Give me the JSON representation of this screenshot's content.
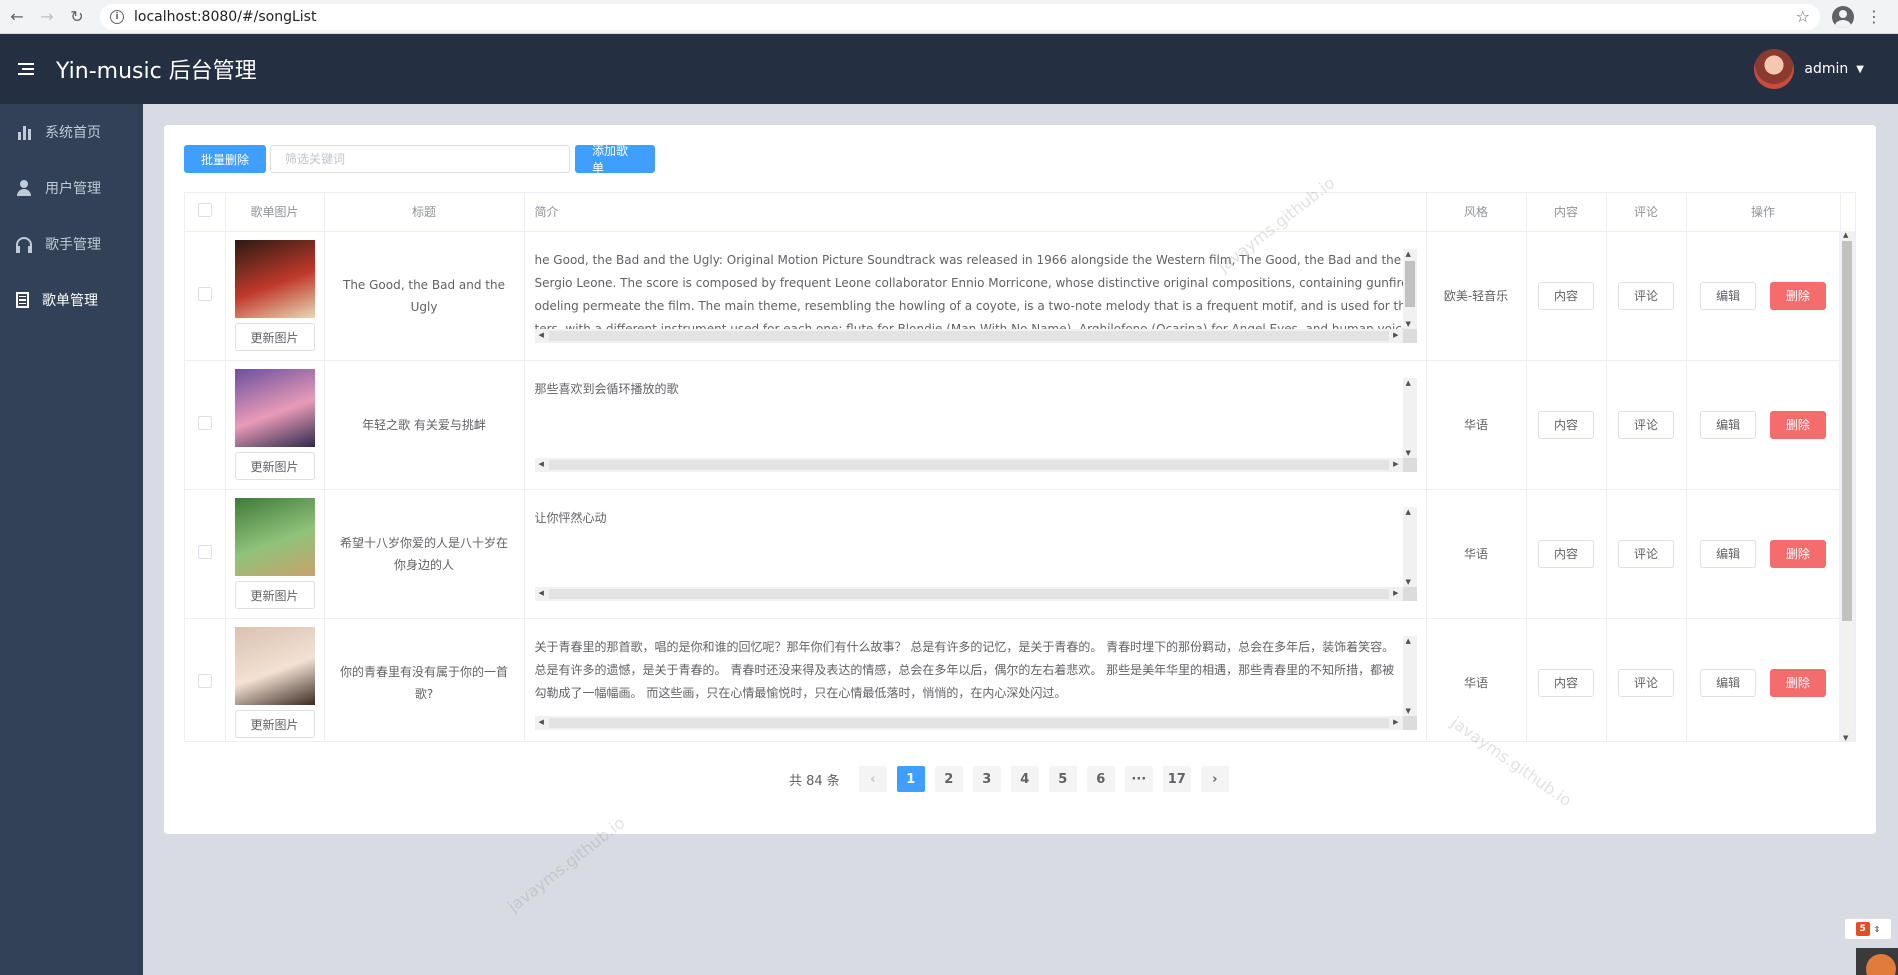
{
  "browser": {
    "url": "localhost:8080/#/songList"
  },
  "header": {
    "title": "Yin-music 后台管理",
    "user_name": "admin"
  },
  "sidebar": {
    "items": [
      {
        "label": "系统首页",
        "icon": "bar-chart-icon",
        "active": false
      },
      {
        "label": "用户管理",
        "icon": "user-icon",
        "active": false
      },
      {
        "label": "歌手管理",
        "icon": "headset-icon",
        "active": false
      },
      {
        "label": "歌单管理",
        "icon": "document-icon",
        "active": true
      }
    ]
  },
  "toolbar": {
    "batch_delete_label": "批量删除",
    "search_placeholder": "筛选关键词",
    "add_label": "添加歌单"
  },
  "table": {
    "headers": {
      "cover": "歌单图片",
      "title": "标题",
      "intro": "简介",
      "style": "风格",
      "content": "内容",
      "comment": "评论",
      "actions": "操作"
    },
    "update_image_label": "更新图片",
    "content_btn_label": "内容",
    "comment_btn_label": "评论",
    "edit_label": "编辑",
    "delete_label": "删除",
    "rows": [
      {
        "title": "The Good, the Bad and the Ugly",
        "intro_lines": [
          "he Good, the Bad and the Ugly: Original Motion Picture Soundtrack was released in 1966 alongside the Western film, The Good, the Bad and the Ugly, directed by",
          "Sergio Leone. The score is composed by frequent Leone collaborator Ennio Morricone, whose distinctive original compositions, containing gunfire, whistling, and y",
          "odeling permeate the film. The main theme, resembling the howling of a coyote, is a two-note melody that is a frequent motif, and is used for the three main charac",
          "ters, with a different instrument used for each one: flute for Blondie (Man With No Name), Arghilofono (Ocarina) for Angel Eyes, and human voices for Tuco."
        ],
        "style": "欧美-轻音乐",
        "cover_colors": [
          "#2b1a12",
          "#c0392b",
          "#e8d9b5"
        ]
      },
      {
        "title": "年轻之歌 有关爱与挑衅",
        "intro_lines": [
          "那些喜欢到会循环播放的歌"
        ],
        "style": "华语",
        "cover_colors": [
          "#6b4f9e",
          "#e89bb8",
          "#2d2a4a"
        ]
      },
      {
        "title": "希望十八岁你爱的人是八十岁在你身边的人",
        "intro_lines": [
          "让你怦然心动"
        ],
        "style": "华语",
        "cover_colors": [
          "#3f7a3a",
          "#8fc37a",
          "#c9a26b"
        ]
      },
      {
        "title": "你的青春里有没有属于你的一首歌?",
        "intro_lines": [
          "关于青春里的那首歌，唱的是你和谁的回忆呢？那年你们有什么故事？ 总是有许多的记忆，是关于青春的。 青春时埋下的那份羁动，总会在多年后，装饰着笑容。",
          "总是有许多的遗憾，是关于青春的。 青春时还没来得及表达的情感，总会在多年以后，偶尔的左右着悲欢。 那些是美年华里的相遇，那些青春里的不知所措，都被",
          "勾勒成了一幅幅画。 而这些画，只在心情最愉悦时，只在心情最低落时，悄悄的，在内心深处闪过。"
        ],
        "style": "华语",
        "cover_colors": [
          "#d9c2b0",
          "#f3e1d3",
          "#3a2a22"
        ]
      }
    ]
  },
  "pagination": {
    "total_text": "共 84 条",
    "pages": [
      "1",
      "2",
      "3",
      "4",
      "5",
      "6",
      "···",
      "17"
    ],
    "current": "1",
    "prev": "‹",
    "next": "›"
  },
  "watermark_text": "javayms.github.io"
}
